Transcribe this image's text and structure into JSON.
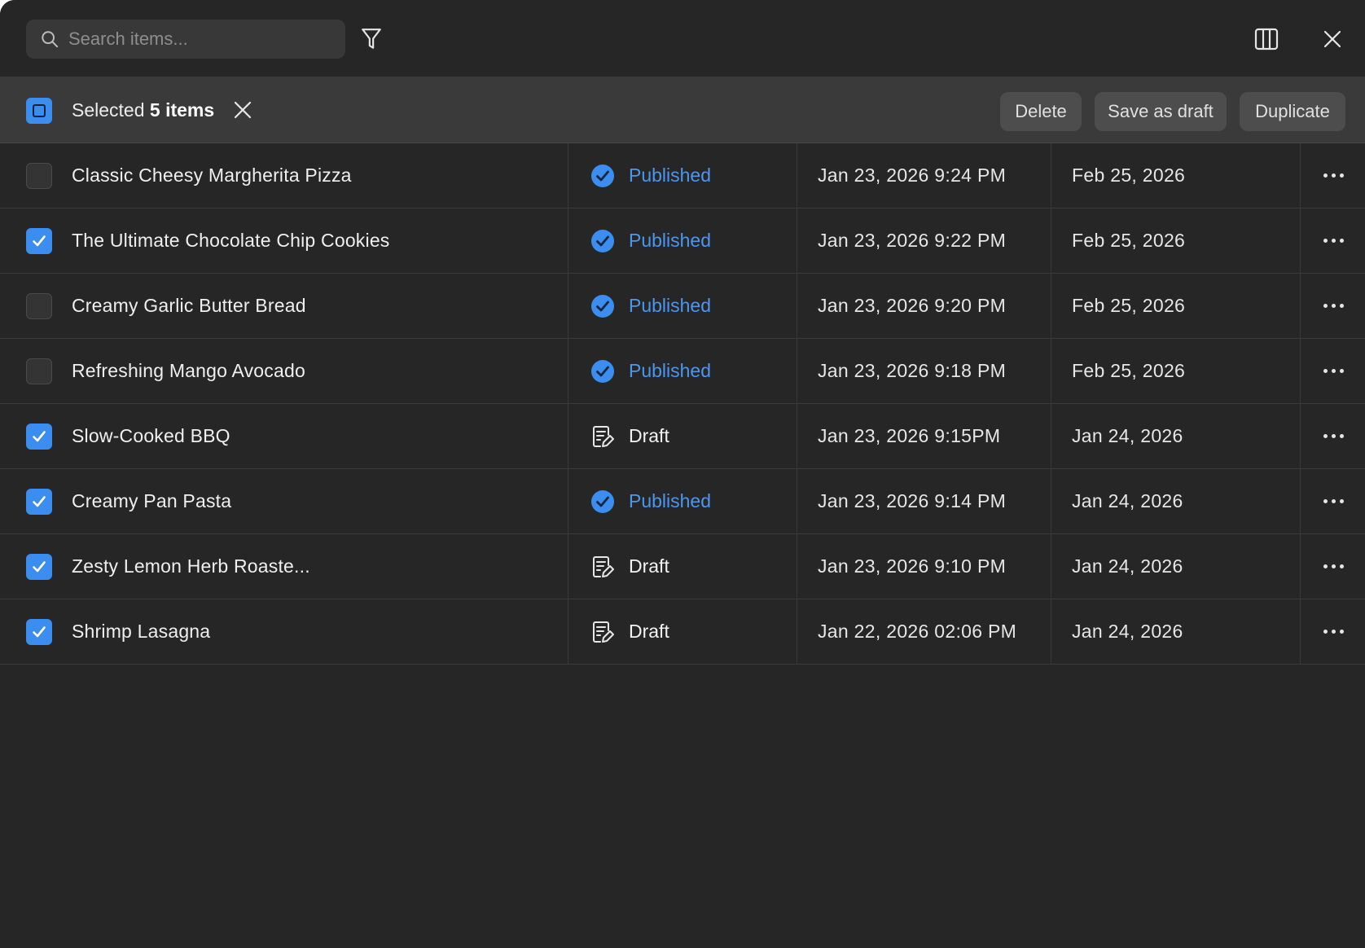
{
  "search": {
    "placeholder": "Search items..."
  },
  "selection": {
    "prefix": "Selected",
    "count_label": "5 items"
  },
  "actions": {
    "delete": "Delete",
    "save_draft": "Save as draft",
    "duplicate": "Duplicate"
  },
  "colors": {
    "accent": "#3b8ef0",
    "published": "#4a97f2",
    "background": "#262626"
  },
  "rows": [
    {
      "name": "Classic Cheesy Margherita Pizza",
      "checked": false,
      "status": "Published",
      "created": "Jan 23, 2026  9:24 PM",
      "updated": "Feb 25, 2026"
    },
    {
      "name": "The Ultimate Chocolate Chip Cookies",
      "checked": true,
      "status": "Published",
      "created": "Jan 23, 2026  9:22 PM",
      "updated": "Feb 25, 2026"
    },
    {
      "name": "Creamy Garlic Butter Bread",
      "checked": false,
      "status": "Published",
      "created": "Jan 23, 2026  9:20 PM",
      "updated": "Feb 25, 2026"
    },
    {
      "name": "Refreshing Mango Avocado",
      "checked": false,
      "status": "Published",
      "created": "Jan 23, 2026  9:18 PM",
      "updated": "Feb 25, 2026"
    },
    {
      "name": "Slow-Cooked BBQ",
      "checked": true,
      "status": "Draft",
      "created": "Jan 23, 2026  9:15PM",
      "updated": "Jan 24, 2026"
    },
    {
      "name": "Creamy Pan Pasta",
      "checked": true,
      "status": "Published",
      "created": "Jan 23, 2026  9:14 PM",
      "updated": "Jan 24, 2026"
    },
    {
      "name": "Zesty Lemon Herb Roaste...",
      "checked": true,
      "status": "Draft",
      "created": "Jan 23, 2026  9:10 PM",
      "updated": "Jan 24, 2026"
    },
    {
      "name": "Shrimp Lasagna",
      "checked": true,
      "status": "Draft",
      "created": "Jan 22, 2026  02:06 PM",
      "updated": "Jan 24, 2026"
    }
  ]
}
